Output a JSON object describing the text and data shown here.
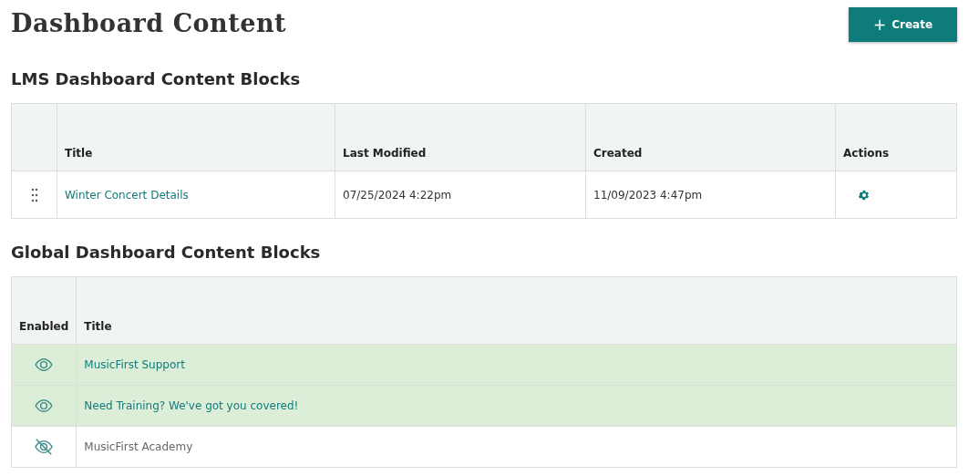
{
  "page": {
    "title": "Dashboard Content",
    "create_button": {
      "icon": "+",
      "label": "Create"
    }
  },
  "lms_blocks": {
    "heading": "LMS Dashboard Content Blocks",
    "columns": [
      "Title",
      "Last Modified",
      "Created",
      "Actions"
    ],
    "rows": [
      {
        "title": "Winter Concert Details",
        "last_modified": "07/25/2024 4:22pm",
        "created": "11/09/2023 4:47pm"
      }
    ]
  },
  "global_blocks": {
    "heading": "Global Dashboard Content Blocks",
    "columns": [
      "Enabled",
      "Title"
    ],
    "rows": [
      {
        "title": "MusicFirst Support",
        "enabled": true
      },
      {
        "title": "Need Training? We've got you covered!",
        "enabled": true
      },
      {
        "title": "MusicFirst Academy",
        "enabled": false
      }
    ]
  }
}
